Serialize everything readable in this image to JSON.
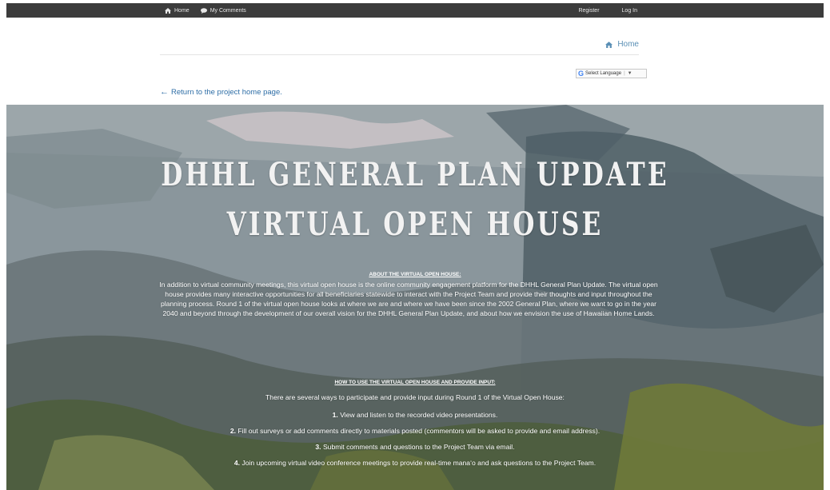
{
  "topnav": {
    "home": "Home",
    "my_comments": "My Comments",
    "register": "Register",
    "login": "Log In"
  },
  "breadcrumb": {
    "home": "Home"
  },
  "language": {
    "label": "Select Language",
    "google_letter": "G",
    "arrow": "▼"
  },
  "back_link": {
    "arrow": "←",
    "label": "Return to the project home page."
  },
  "hero": {
    "title_line1": "DHHL GENERAL PLAN UPDATE",
    "title_line2": "VIRTUAL OPEN HOUSE",
    "about_heading": "ABOUT THE VIRTUAL OPEN HOUSE:",
    "about_text": "In addition to virtual community meetings, this virtual open house is the online community engagement platform for the DHHL General Plan Update. The virtual open house provides many interactive opportunities for all beneficiaries statewide to interact with the Project Team and provide their thoughts and input throughout the planning process. Round 1 of the virtual open house looks at where we are and where we have been since the 2002 General Plan, where we want to go in the year 2040 and beyond through the development of our overall vision for the DHHL General Plan Update, and about how we envision the use of Hawaiian Home Lands.",
    "howto_heading": "HOW TO USE THE VIRTUAL OPEN HOUSE AND PROVIDE INPUT:",
    "howto_intro": "There are several ways to participate and provide input during Round 1 of the Virtual Open House:",
    "steps": [
      {
        "num": "1.",
        "text": "View and listen to the recorded video presentations."
      },
      {
        "num": "2.",
        "text": "Fill out surveys or add comments directly to materials posted (commentors will be asked to provide and email address)."
      },
      {
        "num": "3.",
        "text": "Submit comments and questions to the Project Team via email."
      },
      {
        "num": "4.",
        "text": "Join upcoming virtual video conference meetings to provide real-time mana‘o and ask questions to the Project Team."
      }
    ]
  },
  "colors": {
    "topbar": "#3c3c3c",
    "link": "#2e6ea6",
    "breadcrumb": "#5a8fb5"
  }
}
